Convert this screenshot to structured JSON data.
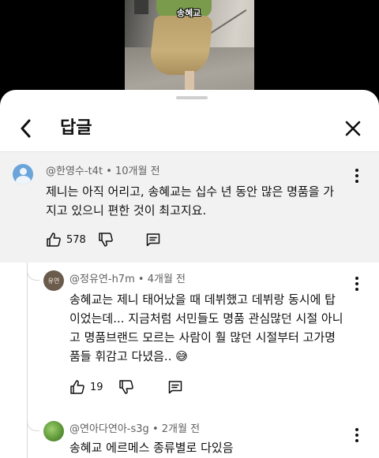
{
  "video": {
    "caption": "송혜교"
  },
  "header": {
    "title": "답글"
  },
  "parent_comment": {
    "author": "@한영수-t4t",
    "time": "10개월 전",
    "text_line1": "제니는 아직 어리고, 송혜교는 십수 년 동안 많은 명품을 가",
    "text_line2": "지고 있으니 편한 것이 최고지요.",
    "likes": "578"
  },
  "replies": [
    {
      "author": "@정유연-h7m",
      "time": "4개월 전",
      "avatar_text": "유연",
      "lines": [
        "송혜교는 제니 태어났을 때 데뷔했고 데뷔랑 동시에 탑",
        "이었는데... 지금처럼 서민들도 명품 관심많던 시절 아니",
        "고 명품브랜드 모르는 사람이 훨 많던 시절부터 고가명",
        "품들 휘감고 다녔음.. 😅"
      ],
      "likes": "19"
    },
    {
      "author": "@연아다연아-s3g",
      "time": "2개월 전",
      "lines": [
        "송혜교 에르메스 종류별로 다있음"
      ]
    }
  ],
  "separator": "•",
  "icons": [
    "back-arrow-icon",
    "close-icon",
    "more-vert-icon",
    "thumb-up-icon",
    "thumb-down-icon",
    "reply-icon"
  ]
}
